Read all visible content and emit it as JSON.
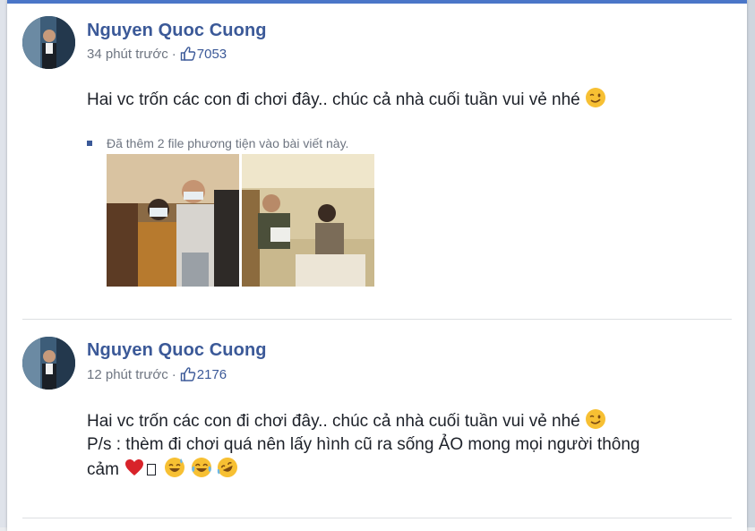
{
  "posts": [
    {
      "author": "Nguyen Quoc Cuong",
      "time": "34 phút trước",
      "separator": "·",
      "likes": "7053",
      "text_lines": [
        "Hai vc trốn các con đi chơi đây.. chúc cả nhà cuối tuần vui vẻ nhé"
      ],
      "added_media_note": "Đã thêm 2 file phương tiện vào bài viết này."
    },
    {
      "author": "Nguyen Quoc Cuong",
      "time": "12 phút trước",
      "separator": "·",
      "likes": "2176",
      "text_lines": [
        "Hai vc trốn các con đi chơi đây.. chúc cả nhà cuối tuần vui vẻ nhé",
        "P/s : thèm đi chơi quá nên lấy hình cũ ra sống ẢO mong mọi người thông",
        "cảm"
      ]
    }
  ],
  "colors": {
    "author": "#3b5998",
    "meta": "#6e7581",
    "accent_top": "#4a76c8"
  },
  "icons": [
    "thumbs-up-icon",
    "wink-emoji-icon",
    "red-heart-emoji-icon",
    "missing-glyph-box",
    "sweat-smile-emoji-icon",
    "tears-of-joy-emoji-icon",
    "rolling-laughing-emoji-icon"
  ]
}
